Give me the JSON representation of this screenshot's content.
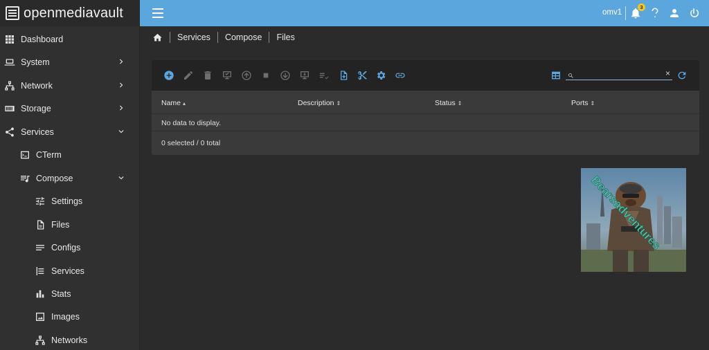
{
  "app": {
    "brand": "openmediavault"
  },
  "sidebar": {
    "items": [
      {
        "label": "Dashboard",
        "icon": "dashboard-grid-icon"
      },
      {
        "label": "System",
        "icon": "laptop-icon",
        "chevron": "chevron-right-icon"
      },
      {
        "label": "Network",
        "icon": "network-icon",
        "chevron": "chevron-right-icon"
      },
      {
        "label": "Storage",
        "icon": "storage-icon",
        "chevron": "chevron-right-icon"
      },
      {
        "label": "Services",
        "icon": "share-icon",
        "chevron": "chevron-down-icon"
      },
      {
        "label": "CTerm",
        "icon": "terminal-icon"
      },
      {
        "label": "Compose",
        "icon": "playlist-music-icon",
        "chevron": "chevron-down-icon"
      },
      {
        "label": "Settings",
        "icon": "tune-icon"
      },
      {
        "label": "Files",
        "icon": "file-icon"
      },
      {
        "label": "Configs",
        "icon": "lines-icon"
      },
      {
        "label": "Services",
        "icon": "list-box-icon"
      },
      {
        "label": "Stats",
        "icon": "bar-chart-icon"
      },
      {
        "label": "Images",
        "icon": "image-icon"
      },
      {
        "label": "Networks",
        "icon": "network-icon"
      }
    ]
  },
  "topbar": {
    "hostname": "omv1",
    "notification_count": "3",
    "accent": "#5aa6dd"
  },
  "breadcrumb": [
    "Services",
    "Compose",
    "Files"
  ],
  "toolbar": {
    "buttons": [
      {
        "name": "add-icon",
        "enabled": true
      },
      {
        "name": "edit-icon",
        "enabled": false
      },
      {
        "name": "delete-icon",
        "enabled": false
      },
      {
        "name": "check-monitor-icon",
        "enabled": false
      },
      {
        "name": "arrow-up-circle-icon",
        "enabled": false
      },
      {
        "name": "stop-icon",
        "enabled": false
      },
      {
        "name": "arrow-down-circle-icon",
        "enabled": false
      },
      {
        "name": "download-monitor-icon",
        "enabled": false
      },
      {
        "name": "check-list-icon",
        "enabled": false
      },
      {
        "name": "file-plus-icon",
        "enabled": true
      },
      {
        "name": "scissors-icon",
        "enabled": true
      },
      {
        "name": "gear-icon",
        "enabled": true
      },
      {
        "name": "link-icon",
        "enabled": true
      }
    ],
    "search": {
      "placeholder": "",
      "value": ""
    }
  },
  "table": {
    "columns": [
      {
        "label": "Name",
        "sort": "▴"
      },
      {
        "label": "Description",
        "sort": "⇕"
      },
      {
        "label": "Status",
        "sort": "⇕"
      },
      {
        "label": "Ports",
        "sort": "⇕"
      }
    ],
    "empty_text": "No data to display.",
    "footer": "0 selected / 0 total"
  },
  "image": {
    "caption": "Bearsadventures"
  }
}
